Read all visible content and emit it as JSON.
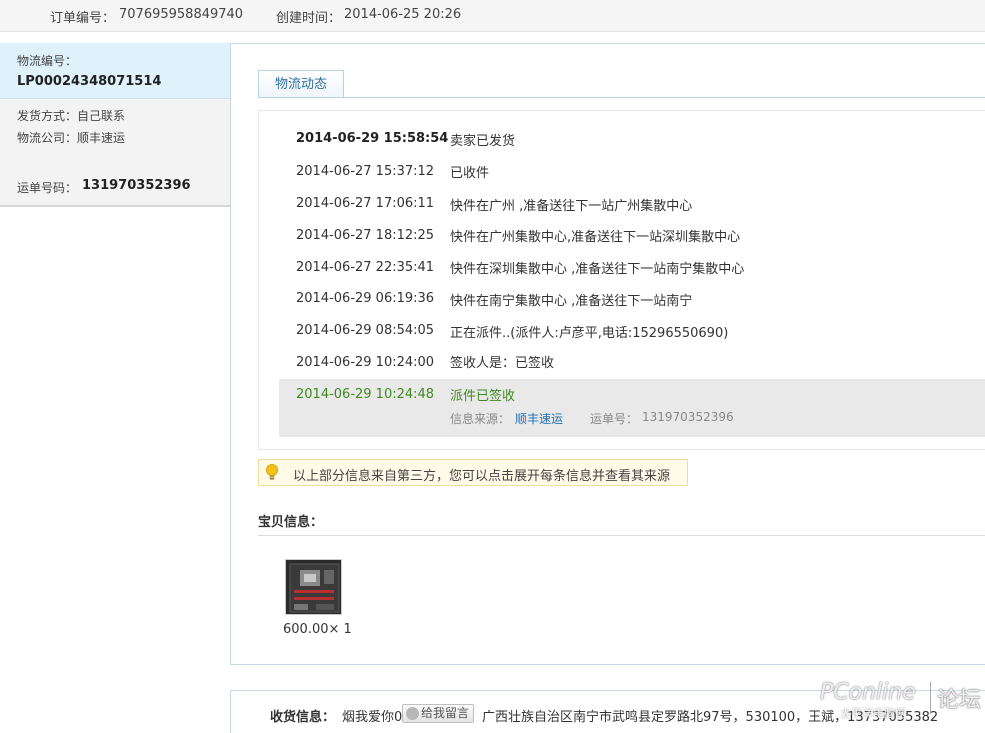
{
  "order": {
    "id_label": "订单编号：",
    "id_value": "707695958849740",
    "created_label": "创建时间：",
    "created_value": "2014-06-25 20:26"
  },
  "sidebar": {
    "logistics_no_label": "物流编号：",
    "logistics_no_value": "LP00024348071514",
    "shipping_method": "发货方式：自己联系",
    "company": "物流公司：顺丰速运",
    "waybill_label": "运单号码：",
    "waybill_value": "131970352396"
  },
  "tab": {
    "label": "物流动态"
  },
  "tracking": [
    {
      "time": "2014-06-29 15:58:54",
      "text": "卖家已发货"
    },
    {
      "time": "2014-06-27 15:37:12",
      "text": "已收件"
    },
    {
      "time": "2014-06-27 17:06:11",
      "text": "快件在广州 ,准备送往下一站广州集散中心"
    },
    {
      "time": "2014-06-27 18:12:25",
      "text": "快件在广州集散中心,准备送往下一站深圳集散中心"
    },
    {
      "time": "2014-06-27 22:35:41",
      "text": "快件在深圳集散中心 ,准备送往下一站南宁集散中心"
    },
    {
      "time": "2014-06-29 06:19:36",
      "text": "快件在南宁集散中心 ,准备送往下一站南宁"
    },
    {
      "time": "2014-06-29 08:54:05",
      "text": "正在派件..(派件人:卢彦平,电话:15296550690)"
    },
    {
      "time": "2014-06-29 10:24:00",
      "text": "签收人是：已签收"
    },
    {
      "time": "2014-06-29 10:24:48",
      "text": "派件已签收"
    }
  ],
  "source": {
    "label": "信息来源：",
    "link": "顺丰速运",
    "waybill_label": "运单号：",
    "waybill_value": "131970352396"
  },
  "tip": {
    "text": "以上部分信息来自第三方，您可以点击展开每条信息并查看其来源"
  },
  "goods": {
    "title": "宝贝信息：",
    "price_qty": "600.00× 1"
  },
  "receiver": {
    "label": "收货信息：",
    "name_prefix": "烟我爱你0",
    "message_button": "给我留言",
    "address": "广西壮族自治区南宁市武鸣县定罗路北97号，530100，王斌，13737055382"
  },
  "watermark": {
    "logo": "PConline",
    "sub": "太平洋电脑网",
    "forum": "论坛"
  },
  "colors": {
    "sidebar_head_bg": "#dff1fb",
    "link": "#1f6fb5",
    "latest_status": "#3e8a1e",
    "tab_text": "#2b6ea1"
  }
}
